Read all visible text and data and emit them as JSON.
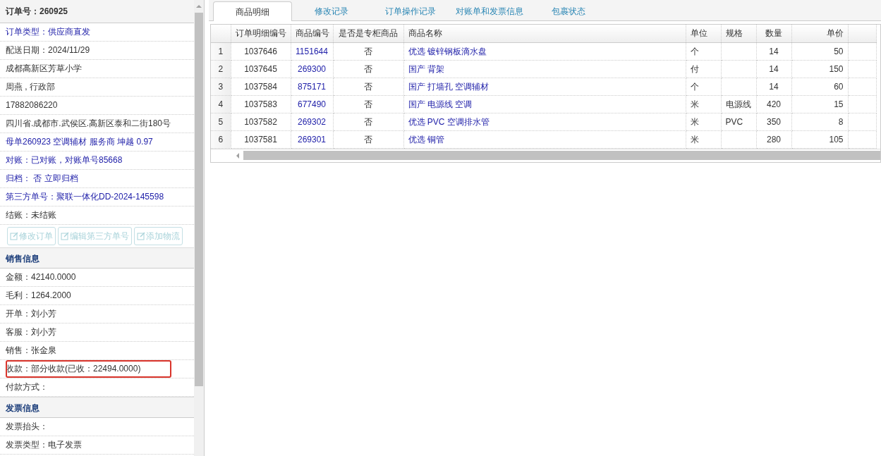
{
  "order_panel": {
    "title": "订单号：260925",
    "items": [
      {
        "text": "订单类型：供应商直发",
        "link": true
      },
      {
        "text": "配送日期：2024/11/29",
        "link": false
      },
      {
        "text": "成都高新区芳草小学",
        "link": false
      },
      {
        "text": "周燕 , 行政部",
        "link": false
      },
      {
        "text": "17882086220",
        "link": false
      },
      {
        "text": "四川省.成都市.武侯区.高新区泰和二街180号",
        "link": false
      },
      {
        "text": "母单260923 空调辅材 服务商 坤越 0.97",
        "link": true
      },
      {
        "text": "对账：已对账，对账单号85668",
        "link": true
      },
      {
        "text": "归档： 否 立即归档",
        "link": true
      },
      {
        "text": "第三方单号：聚联一体化DD-2024-145598",
        "link": true
      },
      {
        "text": "结账：未结账",
        "link": false
      }
    ],
    "buttons": [
      {
        "label": "修改订单",
        "disabled": true
      },
      {
        "label": "编辑第三方单号",
        "disabled": true
      },
      {
        "label": "添加物流",
        "disabled": true
      }
    ]
  },
  "sales_section": {
    "title": "销售信息",
    "items": [
      {
        "text": "金额：42140.0000",
        "highlighted": false
      },
      {
        "text": "毛利：1264.2000",
        "highlighted": false
      },
      {
        "text": "开单：刘小芳",
        "highlighted": false
      },
      {
        "text": "客服：刘小芳",
        "highlighted": false
      },
      {
        "text": "销售：张金泉",
        "highlighted": false
      },
      {
        "text": "收款：部分收款(已收：22494.0000)",
        "highlighted": true
      },
      {
        "text": "付款方式：",
        "highlighted": false
      }
    ]
  },
  "invoice_section": {
    "title": "发票信息",
    "items": [
      {
        "text": "发票抬头："
      },
      {
        "text": "发票类型：电子发票"
      }
    ]
  },
  "tabs": [
    {
      "label": "商品明细",
      "selected": true
    },
    {
      "label": "修改记录",
      "selected": false
    },
    {
      "label": "订单操作记录",
      "selected": false
    },
    {
      "label": "对账单和发票信息",
      "selected": false
    },
    {
      "label": "包裹状态",
      "selected": false
    }
  ],
  "table": {
    "columns": [
      "订单明细编号",
      "商品编号",
      "是否是专柜商品",
      "商品名称",
      "单位",
      "规格",
      "数量",
      "单价"
    ],
    "rows": [
      {
        "index": "1",
        "detail_no": "1037646",
        "product_no": "1151644",
        "counter": "否",
        "name": "优选 镀锌钢板滴水盘",
        "unit": "个",
        "spec": "",
        "qty": "14",
        "price": "50"
      },
      {
        "index": "2",
        "detail_no": "1037645",
        "product_no": "269300",
        "counter": "否",
        "name": "国产 背架",
        "unit": "付",
        "spec": "",
        "qty": "14",
        "price": "150"
      },
      {
        "index": "3",
        "detail_no": "1037584",
        "product_no": "875171",
        "counter": "否",
        "name": "国产 打墙孔 空调辅材",
        "unit": "个",
        "spec": "",
        "qty": "14",
        "price": "60"
      },
      {
        "index": "4",
        "detail_no": "1037583",
        "product_no": "677490",
        "counter": "否",
        "name": "国产 电源线 空调",
        "unit": "米",
        "spec": "电源线",
        "qty": "420",
        "price": "15"
      },
      {
        "index": "5",
        "detail_no": "1037582",
        "product_no": "269302",
        "counter": "否",
        "name": "优选 PVC 空调排水管",
        "unit": "米",
        "spec": "PVC",
        "qty": "350",
        "price": "8"
      },
      {
        "index": "6",
        "detail_no": "1037581",
        "product_no": "269301",
        "counter": "否",
        "name": "优选 铜管",
        "unit": "米",
        "spec": "",
        "qty": "280",
        "price": "105"
      }
    ]
  }
}
